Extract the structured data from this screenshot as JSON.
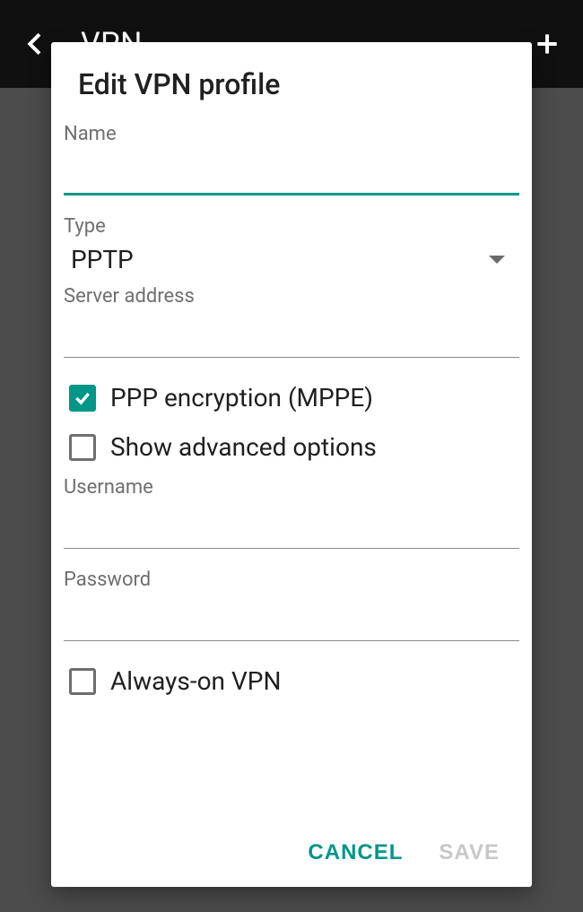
{
  "header": {
    "title": "VPN"
  },
  "dialog": {
    "title": "Edit VPN profile",
    "fields": {
      "name_label": "Name",
      "name_value": "",
      "type_label": "Type",
      "type_value": "PPTP",
      "server_label": "Server address",
      "server_value": "",
      "ppp_label": "PPP encryption (MPPE)",
      "adv_label": "Show advanced options",
      "username_label": "Username",
      "username_value": "",
      "password_label": "Password",
      "password_value": "",
      "always_label": "Always-on VPN"
    },
    "actions": {
      "cancel": "CANCEL",
      "save": "SAVE"
    }
  },
  "colors": {
    "accent": "#009688"
  }
}
